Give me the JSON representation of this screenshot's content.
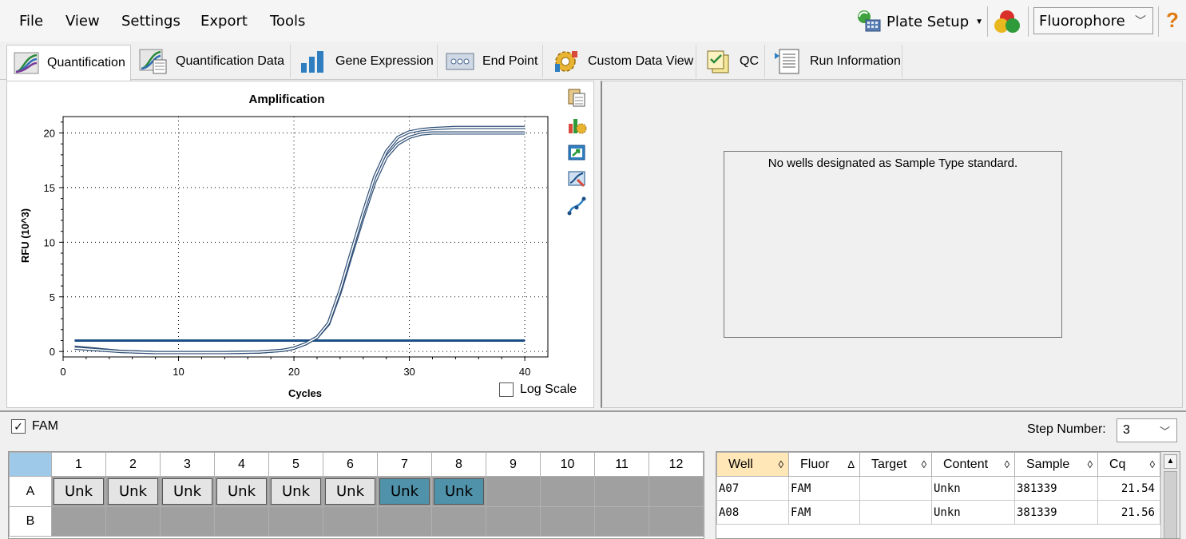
{
  "menu": {
    "items": [
      "File",
      "View",
      "Settings",
      "Export",
      "Tools"
    ],
    "plate_setup": "Plate Setup",
    "fluorophore_select": "Fluorophore",
    "help": "?"
  },
  "tabs": [
    {
      "label": "Quantification",
      "icon": "amplification-curve-icon",
      "active": true
    },
    {
      "label": "Quantification Data",
      "icon": "quantification-data-icon"
    },
    {
      "label": "Gene Expression",
      "icon": "bar-chart-icon"
    },
    {
      "label": "End Point",
      "icon": "end-point-icon"
    },
    {
      "label": "Custom Data View",
      "icon": "gear-icon"
    },
    {
      "label": "QC",
      "icon": "qc-checklist-icon"
    },
    {
      "label": "Run Information",
      "icon": "document-icon"
    }
  ],
  "amplification": {
    "log_scale_label": "Log Scale",
    "log_scale_checked": false,
    "side_tools": [
      "copy-icon",
      "chart-options-icon",
      "export-icon",
      "zoom-chart-icon",
      "curve-fit-icon"
    ]
  },
  "chart_data": {
    "type": "line",
    "title": "Amplification",
    "xlabel": "Cycles",
    "ylabel": "RFU (10^3)",
    "xlim": [
      0,
      42
    ],
    "ylim": [
      -0.5,
      21.5
    ],
    "x_ticks": [
      0,
      10,
      20,
      30,
      40
    ],
    "y_ticks": [
      0,
      5,
      10,
      15,
      20
    ],
    "grid": true,
    "series": [
      {
        "color": "#3a5f8a",
        "x": [
          1,
          3,
          5,
          8,
          10,
          14,
          17,
          19,
          20,
          21,
          22,
          23,
          24,
          25,
          26,
          27,
          28,
          29,
          30,
          31,
          32,
          34,
          36,
          38,
          40
        ],
        "y": [
          0.4,
          0.2,
          0.0,
          -0.1,
          -0.1,
          -0.1,
          -0.05,
          0.1,
          0.3,
          0.7,
          1.3,
          2.5,
          5.4,
          8.9,
          12.3,
          15.5,
          17.8,
          19.0,
          19.6,
          19.9,
          20.0,
          20.0,
          20.0,
          20.0,
          20.0
        ]
      },
      {
        "color": "#3a5f8a",
        "x": [
          1,
          3,
          5,
          8,
          10,
          14,
          17,
          19,
          20,
          21,
          22,
          23,
          24,
          25,
          26,
          27,
          28,
          29,
          30,
          31,
          32,
          34,
          36,
          38,
          40
        ],
        "y": [
          0.3,
          0.15,
          0.0,
          -0.1,
          -0.1,
          -0.1,
          -0.05,
          0.1,
          0.3,
          0.7,
          1.3,
          2.6,
          5.6,
          9.2,
          12.7,
          16.0,
          18.3,
          19.6,
          20.1,
          20.3,
          20.4,
          20.5,
          20.5,
          20.5,
          20.5
        ]
      }
    ],
    "threshold": {
      "value": 1.0,
      "color": "#1b4f86"
    }
  },
  "standard_curve": {
    "message": "No wells designated as Sample Type standard."
  },
  "fluor_row": {
    "fam_label": "FAM",
    "fam_checked": true,
    "step_label": "Step Number:",
    "step_value": "3"
  },
  "plate": {
    "columns": [
      "1",
      "2",
      "3",
      "4",
      "5",
      "6",
      "7",
      "8",
      "9",
      "10",
      "11",
      "12"
    ],
    "rows": [
      {
        "label": "A",
        "wells": [
          "Unk",
          "Unk",
          "Unk",
          "Unk",
          "Unk",
          "Unk",
          "Unk",
          "Unk",
          "",
          "",
          "",
          ""
        ],
        "selected": [
          false,
          false,
          false,
          false,
          false,
          false,
          true,
          true,
          false,
          false,
          false,
          false
        ]
      },
      {
        "label": "B",
        "wells": [
          "",
          "",
          "",
          "",
          "",
          "",
          "",
          "",
          "",
          "",
          "",
          ""
        ],
        "selected": [
          false,
          false,
          false,
          false,
          false,
          false,
          false,
          false,
          false,
          false,
          false,
          false
        ]
      }
    ]
  },
  "results": {
    "headers": [
      {
        "label": "Well",
        "sort": "◊"
      },
      {
        "label": "Fluor",
        "sort": "Δ"
      },
      {
        "label": "Target",
        "sort": "◊"
      },
      {
        "label": "Content",
        "sort": "◊"
      },
      {
        "label": "Sample",
        "sort": "◊"
      },
      {
        "label": "Cq",
        "sort": "◊"
      }
    ],
    "rows": [
      {
        "well": "A07",
        "fluor": "FAM",
        "target": "",
        "content": "Unkn",
        "sample": "381339",
        "cq": "21.54"
      },
      {
        "well": "A08",
        "fluor": "FAM",
        "target": "",
        "content": "Unkn",
        "sample": "381339",
        "cq": "21.56"
      }
    ]
  }
}
